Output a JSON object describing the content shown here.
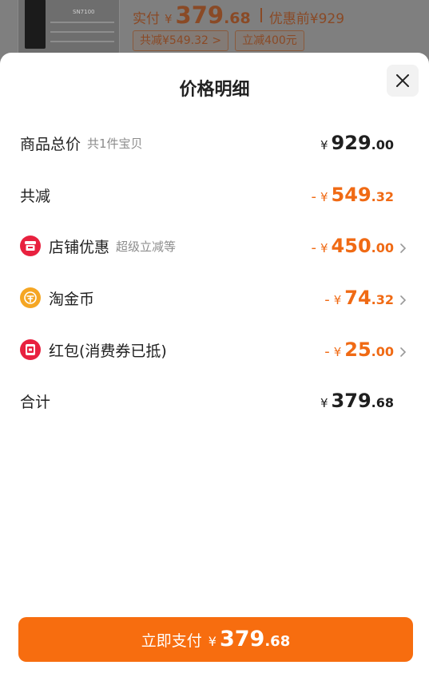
{
  "background": {
    "product_model": "SN7100",
    "actual_pay_label": "实付",
    "currency": "¥",
    "actual_pay_int": "379",
    "actual_pay_dec": ".68",
    "before_discount": "优惠前¥929",
    "tag_total_reduction": "共减¥549.32 >",
    "tag_instant_reduction": "立减400元"
  },
  "sheet": {
    "title": "价格明细",
    "close_icon": "close-icon"
  },
  "rows": [
    {
      "label": "商品总价",
      "sub": "共1件宝贝",
      "minus": "",
      "currency": "¥",
      "int": "929",
      "dec": ".00",
      "highlight": false,
      "chevron": false
    },
    {
      "label": "共减",
      "sub": "",
      "minus": "-",
      "currency": "¥",
      "int": "549",
      "dec": ".32",
      "highlight": true,
      "chevron": false
    },
    {
      "label": "店铺优惠",
      "sub": "超级立减等",
      "icon": "shop-icon",
      "minus": "-",
      "currency": "¥",
      "int": "450",
      "dec": ".00",
      "highlight": true,
      "chevron": true
    },
    {
      "label": "淘金币",
      "sub": "",
      "icon": "coin-icon",
      "minus": "-",
      "currency": "¥",
      "int": "74",
      "dec": ".32",
      "highlight": true,
      "chevron": true
    },
    {
      "label": "红包(消费券已抵)",
      "sub": "",
      "icon": "red-packet-icon",
      "minus": "-",
      "currency": "¥",
      "int": "25",
      "dec": ".00",
      "highlight": true,
      "chevron": true
    },
    {
      "label": "合计",
      "sub": "",
      "minus": "",
      "currency": "¥",
      "int": "379",
      "dec": ".68",
      "highlight": false,
      "chevron": false
    }
  ],
  "pay_button": {
    "label": "立即支付",
    "currency": "¥",
    "int": "379",
    "dec": ".68"
  },
  "colors": {
    "accent": "#f06a14",
    "button": "#f76d0f",
    "shop_icon": "#e8213f",
    "coin_icon": "#f5a623"
  }
}
